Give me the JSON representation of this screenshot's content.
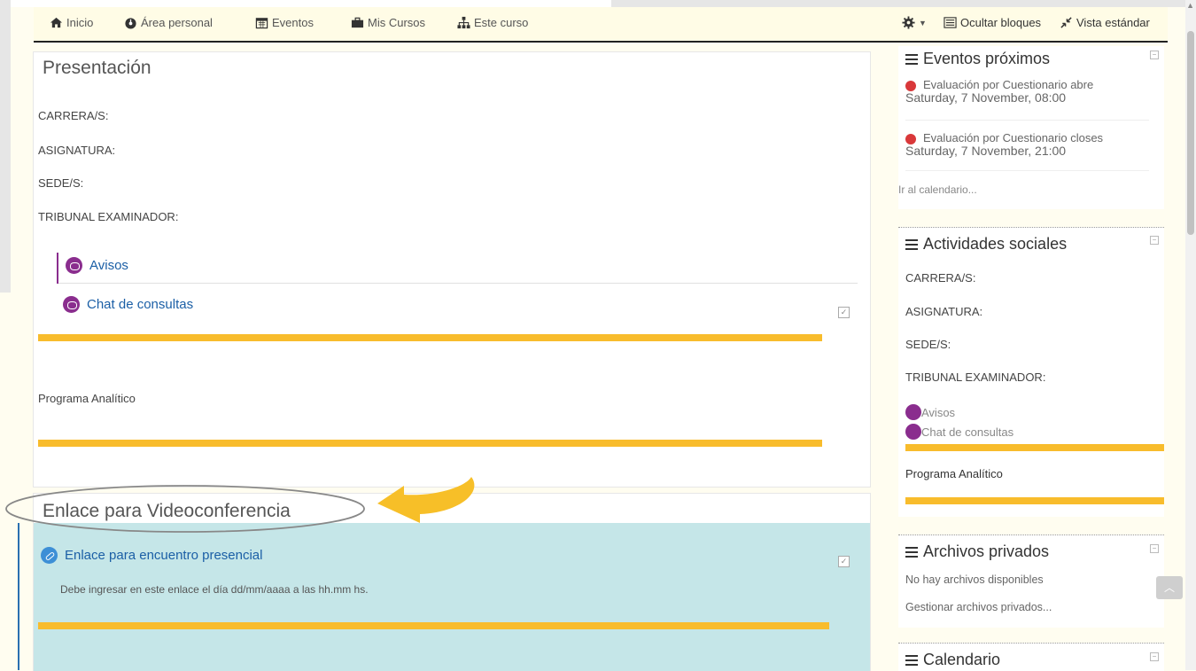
{
  "nav": {
    "items": [
      {
        "label": "Inicio",
        "icon": "home-icon"
      },
      {
        "label": "Área personal",
        "icon": "dashboard-icon"
      },
      {
        "label": "Eventos",
        "icon": "calendar-icon"
      },
      {
        "label": "Mis Cursos",
        "icon": "briefcase-icon"
      },
      {
        "label": "Este curso",
        "icon": "sitemap-icon"
      }
    ],
    "hide_blocks": "Ocultar bloques",
    "standard_view": "Vista estándar"
  },
  "main": {
    "presentation": {
      "title": "Presentación",
      "fields": [
        "CARRERA/S:",
        "ASIGNATURA:",
        "SEDE/S:",
        "TRIBUNAL EXAMINADOR:"
      ],
      "activities": [
        "Avisos",
        "Chat de consultas"
      ],
      "program": "Programa Analítico"
    },
    "video": {
      "title": "Enlace para Videoconferencia",
      "link": "Enlace para encuentro presencial",
      "description": "Debe ingresar en este enlace el día dd/mm/aaaa a las hh.mm hs."
    }
  },
  "blocks": {
    "events": {
      "title": "Eventos próximos",
      "items": [
        {
          "name": "Evaluación por Cuestionario abre",
          "date": "Saturday, 7 November, 08:00"
        },
        {
          "name": "Evaluación por Cuestionario closes",
          "date": "Saturday, 7 November, 21:00"
        }
      ],
      "calendar_link": "Ir al calendario..."
    },
    "social": {
      "title": "Actividades sociales",
      "fields": [
        "CARRERA/S:",
        "ASIGNATURA:",
        "SEDE/S:",
        "TRIBUNAL EXAMINADOR:"
      ],
      "activities": [
        "Avisos",
        "Chat de consultas"
      ],
      "program": "Programa Analítico"
    },
    "files": {
      "title": "Archivos privados",
      "empty": "No hay archivos disponibles",
      "manage": "Gestionar archivos privados..."
    },
    "calendar": {
      "title": "Calendario"
    }
  },
  "colors": {
    "accent_yellow": "#f8bc2c",
    "highlight_teal": "#c5e6e8",
    "link_blue": "#1b5fa6",
    "activity_purple": "#8a2d8e"
  }
}
